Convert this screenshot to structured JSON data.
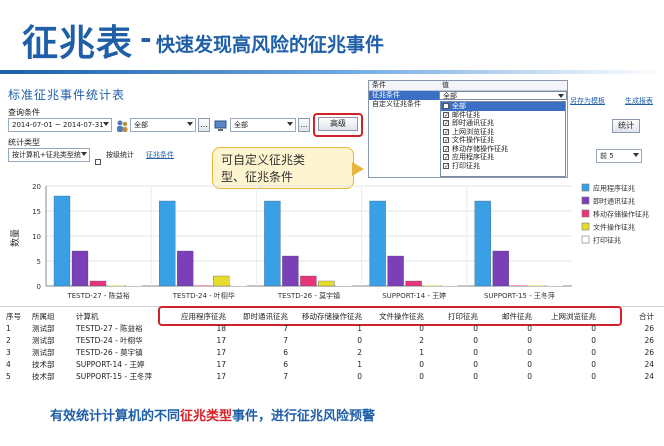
{
  "header": {
    "title": "征兆表",
    "dash": "-",
    "subtitle": "快速发现高风险的征兆事件"
  },
  "window": {
    "title": "标准征兆事件统计表",
    "query_label": "查询条件",
    "stat_type_label": "统计类型"
  },
  "toolbar": {
    "date_range": "2014-07-01 ~ 2014-07-31",
    "group_select": "全部",
    "computer_select": "全部",
    "more_btn": "...",
    "advanced_btn": "高级",
    "stats_btn": "统计",
    "stat_type_select": "按计算机+征兆类型统",
    "level_stats_label": "按级统计",
    "conditions_link": "征兆条件",
    "saveas_link": "另存为模板",
    "gen_report_link": "生成报表",
    "top_select": "前 5"
  },
  "cond_panel": {
    "headers": [
      "条件",
      "值"
    ],
    "rows": [
      {
        "name": "征兆条件",
        "value": "全部"
      },
      {
        "name": "自定义征兆条件",
        "value": ""
      }
    ],
    "list": [
      {
        "label": "全部",
        "checked": false,
        "selected": true
      },
      {
        "label": "邮件征兆",
        "checked": true
      },
      {
        "label": "即时通讯征兆",
        "checked": true
      },
      {
        "label": "上网浏览征兆",
        "checked": true
      },
      {
        "label": "文件操作征兆",
        "checked": true
      },
      {
        "label": "移动存储操作征兆",
        "checked": true
      },
      {
        "label": "应用程序征兆",
        "checked": true
      },
      {
        "label": "打印征兆",
        "checked": true
      }
    ]
  },
  "callout": {
    "line1": "可自定义征兆类",
    "line2": "型、征兆条件"
  },
  "chart_data": {
    "type": "bar",
    "ylabel": "数量",
    "ylim": [
      0,
      20
    ],
    "yticks": [
      0,
      5,
      10,
      15,
      20
    ],
    "categories": [
      "TESTD-27 - 陈益裕",
      "TESTD-24 - 叶栩华",
      "TESTD-26 - 莫宇镇",
      "SUPPORT-14 - 王婷",
      "SUPPORT-15 - 王冬萍"
    ],
    "series": [
      {
        "name": "应用程序征兆",
        "color": "#3aa0e6",
        "values": [
          18,
          17,
          17,
          17,
          17
        ]
      },
      {
        "name": "即时通讯征兆",
        "color": "#7b3fb8",
        "values": [
          7,
          7,
          6,
          6,
          7
        ]
      },
      {
        "name": "移动存储操作征兆",
        "color": "#e8357a",
        "values": [
          1,
          0,
          2,
          1,
          0
        ]
      },
      {
        "name": "文件操作征兆",
        "color": "#e6dc2c",
        "values": [
          0,
          2,
          1,
          0,
          0
        ]
      },
      {
        "name": "打印征兆",
        "color": "#ffffff",
        "values": [
          0,
          0,
          0,
          0,
          0
        ]
      }
    ]
  },
  "table": {
    "columns": [
      "序号",
      "所属组",
      "计算机",
      "应用程序征兆",
      "即时通讯征兆",
      "移动存储操作征兆",
      "文件操作征兆",
      "打印征兆",
      "邮件征兆",
      "上网浏览征兆",
      "合计"
    ],
    "rows": [
      [
        "1",
        "测试部",
        "TESTD-27 - 陈益裕",
        "18",
        "7",
        "1",
        "0",
        "0",
        "0",
        "0",
        "26"
      ],
      [
        "2",
        "测试部",
        "TESTD-24 - 叶栩华",
        "17",
        "7",
        "0",
        "2",
        "0",
        "0",
        "0",
        "26"
      ],
      [
        "3",
        "测试部",
        "TESTD-26 - 莫宇镇",
        "17",
        "6",
        "2",
        "1",
        "0",
        "0",
        "0",
        "26"
      ],
      [
        "4",
        "技术部",
        "SUPPORT-14 - 王婷",
        "17",
        "6",
        "1",
        "0",
        "0",
        "0",
        "0",
        "24"
      ],
      [
        "5",
        "技术部",
        "SUPPORT-15 - 王冬萍",
        "17",
        "7",
        "0",
        "0",
        "0",
        "0",
        "0",
        "24"
      ]
    ]
  },
  "footer": {
    "part1": "有效统计计算机的不同",
    "part2": "征兆类型",
    "part3": "事件，进行征兆风险预警"
  }
}
